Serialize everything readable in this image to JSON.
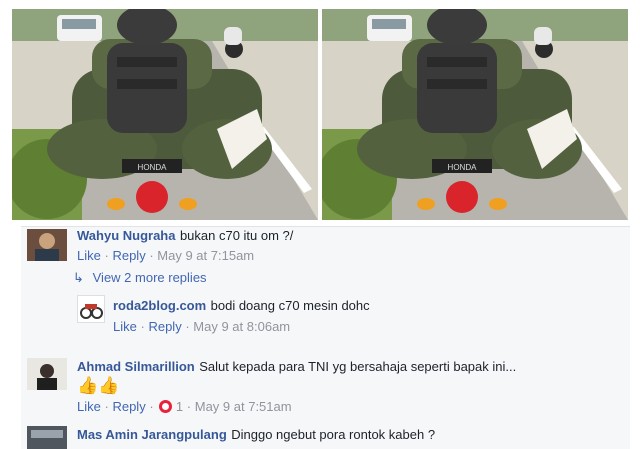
{
  "photos": {
    "left": {
      "icon": "motorbike-photo"
    },
    "right": {
      "icon": "motorbike-photo"
    },
    "plate_text": "HONDA"
  },
  "comments": [
    {
      "name": "Wahyu Nugraha",
      "text": "bukan c70 itu om ?/",
      "like": "Like",
      "reply": "Reply",
      "time": "May 9 at 7:15am",
      "view_more": "View 2 more replies"
    },
    {
      "name": "roda2blog.com",
      "text": "bodi doang c70 mesin dohc",
      "like": "Like",
      "reply": "Reply",
      "time": "May 9 at 8:06am"
    },
    {
      "name": "Ahmad Silmarillion",
      "text": "Salut kepada para TNI yg bersahaja seperti bapak ini...",
      "emoji": "👍👍",
      "like": "Like",
      "reply": "Reply",
      "reaction_count": "1",
      "time": "May 9 at 7:51am"
    },
    {
      "name": "Mas Amin Jarangpulang",
      "text": "Dinggo ngebut pora rontok kabeh ?"
    }
  ],
  "separator": "·",
  "colors": {
    "link": "#4267b2",
    "name": "#365899",
    "meta": "#90949c",
    "background": "#f6f7f9",
    "reaction": "#e9213b"
  }
}
